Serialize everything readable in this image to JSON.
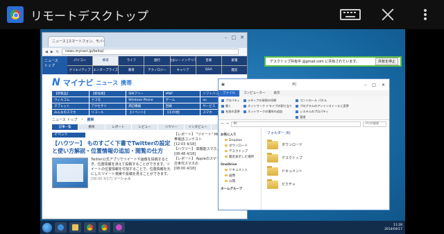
{
  "actionbar": {
    "title": "リモートデスクトップ"
  },
  "notification": {
    "text": "デスクトップ共有中",
    "email_suffix": "@gmail.com に共有されています。",
    "stop_label": "共有を停止"
  },
  "chrome": {
    "tab_title": "ニュース [スマートフォン、モバイル",
    "url": "news.mynavi.jp/keitai/",
    "logo_line1": "ニュース",
    "logo_line2": "トップ",
    "nav_row1": [
      "パソコン",
      "携帯",
      "ライフ",
      "旅行",
      "住まい・インテリア",
      "音楽",
      "家電"
    ],
    "nav_row2": [
      "クリエイティブ",
      "エンタープライズ",
      "教育",
      "テクノロジー",
      "キャリア",
      "Q&A",
      "雑誌"
    ],
    "brand_name": "マイナビ",
    "brand_news": "ニュース",
    "brand_sub": "携帯",
    "categories": [
      "【新製品】",
      "【新技術】",
      "SIMフリー",
      "MNP",
      "ソフトバンク",
      "ウィルコム",
      "ドコモ",
      "Windows Phone",
      "ゲーム",
      "au",
      "タブレット",
      "アクセサリ",
      "周辺機器",
      "回線",
      "サービス",
      "みんなのスマホ",
      "リコール",
      "【イベント】",
      "【その他】",
      "スマホ"
    ],
    "crumb": "ニュース トップ",
    "crumb_current": "携帯",
    "bar_items": [
      "記事一覧",
      "携帯",
      "レポート",
      "レビュー",
      "ハウツー",
      "インタビュー",
      "連載"
    ],
    "section_label": "イベント",
    "headline": "【ハウツー】 ものすごく下書でTwitterの設定と使い方解説・位置情報の追加・閲覧の仕方",
    "article_text": "Twitter公式アプリでツイートや画像を投稿するとき、位置情報を添えて投稿することができます。ツイートの位置情報を付加することで、位置情報を元にしたツイート検索や投稿を見ることができます。",
    "article_date": "[08:00 4/17]",
    "article_tag": "ソーシャル",
    "side_items": [
      "【レポート】 \"ツイート\" Microsoftの携帯電話コンテスト",
      "[12:03 4/18]",
      "【ハウツー】 高機能スマホ入門",
      "[08:48 4/18]",
      "【レポート】 Appleのスマートフォン、次世代スマホの",
      "[08:00 4/18]"
    ]
  },
  "explorer": {
    "title": "PC",
    "tabs": [
      "ファイル",
      "コンピューター",
      "表示"
    ],
    "ribbon": [
      [
        "プロパティ",
        "開く",
        "名前の変更"
      ],
      [
        "メディアの接続の切断",
        "ネットワーク ドライブの割り当て",
        "ネットワークの場所の追加"
      ],
      [
        "コントロール パネル",
        "プログラムのアンインストールと変更",
        "システムのプロパティ",
        "管理"
      ]
    ],
    "address": "PC",
    "search_placeholder": "PCの検索",
    "nav": [
      "お気に入り",
      "Dropbox",
      "ダウンロード",
      "デスクトップ",
      "最近表示した場所",
      "OneDrive",
      "ドキュメント",
      "画像",
      "公開",
      "ホームグループ"
    ],
    "folders_header": "フォルダー (6)",
    "folders": [
      "ダウンロード",
      "デスクトップ",
      "ドキュメント",
      "ピクチャ"
    ]
  },
  "taskbar": {
    "time": "11:28",
    "date": "2014/04/17"
  }
}
